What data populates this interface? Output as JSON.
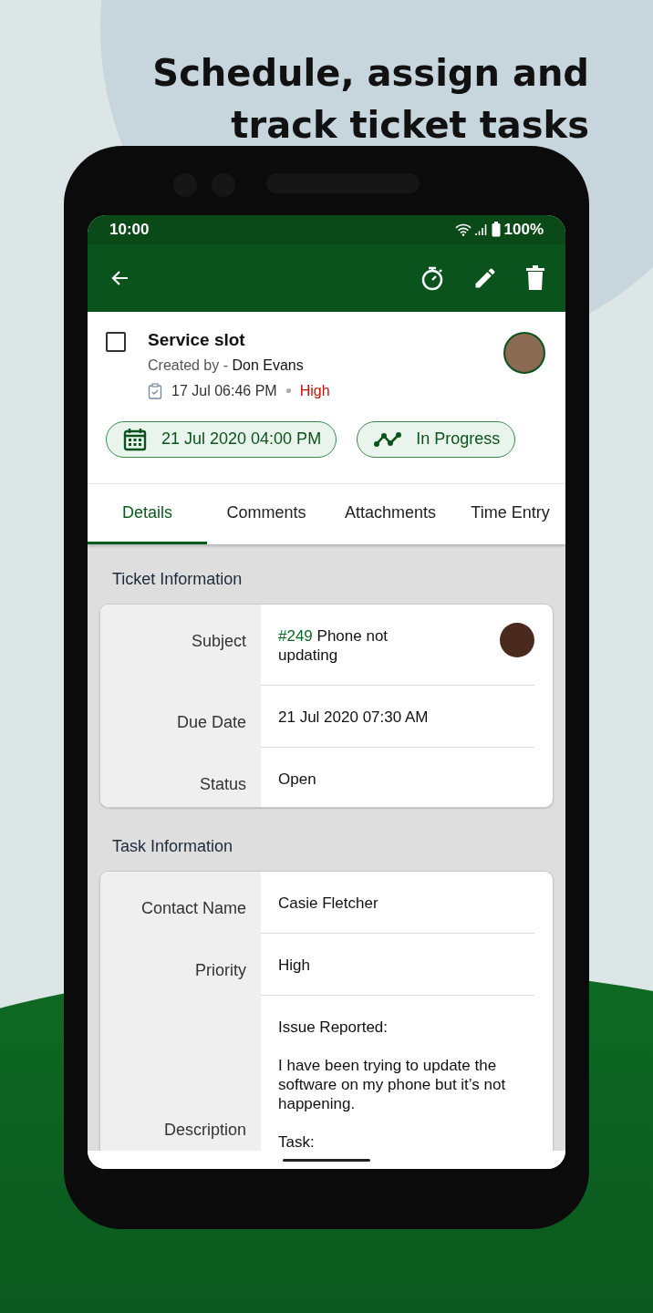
{
  "headline": [
    "Schedule, assign and",
    "track ticket tasks"
  ],
  "status_bar": {
    "time": "10:00",
    "battery": "100%"
  },
  "task": {
    "title": "Service slot",
    "checked": false,
    "created_by_label": "Created by - ",
    "creator": "Don Evans",
    "created": "17 Jul 06:46 PM",
    "priority": "High",
    "due": "21 Jul 2020 04:00 PM",
    "status": "In Progress"
  },
  "tabs": [
    {
      "label": "Details",
      "selected": true
    },
    {
      "label": "Comments",
      "selected": false
    },
    {
      "label": "Attachments",
      "selected": false
    },
    {
      "label": "Time Entry",
      "selected": false
    }
  ],
  "sections": [
    {
      "title": "Ticket Information",
      "rows": [
        {
          "label": "Subject",
          "ticket_number": "#249",
          "value": "Phone not updating",
          "avatar": true
        },
        {
          "label": "Due Date",
          "value": "21 Jul 2020 07:30 AM",
          "avatar": false
        },
        {
          "label": "Status",
          "value": "Open",
          "avatar": false
        }
      ]
    },
    {
      "title": "Task Information",
      "rows": [
        {
          "label": "Contact Name",
          "value": "Casie Fletcher",
          "avatar": false
        },
        {
          "label": "Priority",
          "value": "High",
          "avatar": false
        },
        {
          "label": "Description",
          "value": "Issue Reported:\n\nI have been trying to update the software on my phone but it’s not happening.\n\nTask:",
          "avatar": false
        }
      ]
    }
  ]
}
